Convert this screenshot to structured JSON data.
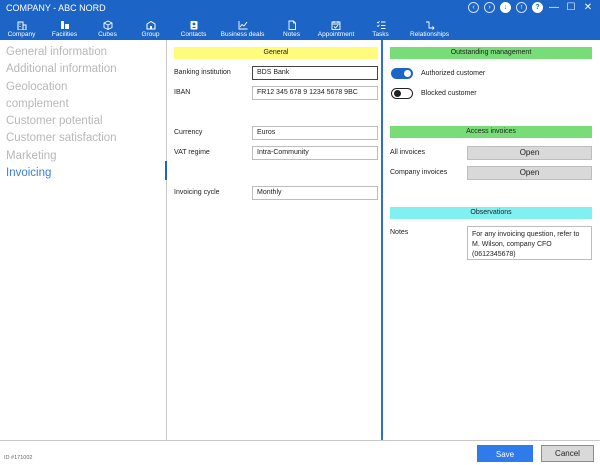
{
  "window": {
    "title": "COMPANY - ABC NORD",
    "controls": {
      "back_icon": "arrow-left-circle-icon",
      "forward_icon": "arrow-right-circle-icon",
      "download_icon": "arrow-down-circle-icon",
      "upload_icon": "arrow-up-circle-icon",
      "help_icon": "help-circle-icon",
      "help_glyph": "?",
      "minimize_glyph": "—",
      "maximize_glyph": "☐",
      "close_glyph": "✕"
    },
    "accent_color": "#1c64c6"
  },
  "toolbar": {
    "items": [
      {
        "label": "Company",
        "icon": "building-icon"
      },
      {
        "label": "Facilities",
        "icon": "facilities-icon"
      },
      {
        "label": "Cubes",
        "icon": "cube-icon"
      },
      {
        "label": "Group",
        "icon": "group-icon"
      },
      {
        "label": "Contacts",
        "icon": "contact-card-icon"
      },
      {
        "label": "Business deals",
        "icon": "chart-line-icon"
      },
      {
        "label": "Notes",
        "icon": "note-icon"
      },
      {
        "label": "Appointment",
        "icon": "calendar-check-icon"
      },
      {
        "label": "Tasks",
        "icon": "tasks-icon"
      },
      {
        "label": "Relationships",
        "icon": "relationships-icon"
      }
    ]
  },
  "sidebar": {
    "items": [
      {
        "label": "General information",
        "active": false
      },
      {
        "label": "Additional information",
        "active": false
      },
      {
        "label": "Geolocation",
        "active": false
      },
      {
        "label": "complement",
        "active": false
      },
      {
        "label": "Customer potential",
        "active": false
      },
      {
        "label": "Customer satisfaction",
        "active": false
      },
      {
        "label": "Marketing",
        "active": false
      },
      {
        "label": "Invoicing",
        "active": true
      }
    ]
  },
  "general": {
    "header": "General",
    "header_color": "#fffb7d",
    "banking_institution_label": "Banking institution",
    "banking_institution_value": "BDS Bank",
    "iban_label": "IBAN",
    "iban_value": "FR12 345 678 9 1234 5678 9BC",
    "currency_label": "Currency",
    "currency_value": "Euros",
    "vat_regime_label": "VAT regime",
    "vat_regime_value": "Intra-Community",
    "invoicing_cycle_label": "Invoicing cycle",
    "invoicing_cycle_value": "Monthly"
  },
  "outstanding": {
    "header": "Outstanding management",
    "header_color": "#78dc78",
    "authorized_label": "Authorized customer",
    "authorized_on": true,
    "blocked_label": "Blocked customer",
    "blocked_on": false
  },
  "access_invoices": {
    "header": "Access invoices",
    "header_color": "#78dc78",
    "all_invoices_label": "All invoices",
    "all_invoices_button": "Open",
    "company_invoices_label": "Company invoices",
    "company_invoices_button": "Open"
  },
  "observations": {
    "header": "Observations",
    "header_color": "#80f0f0",
    "notes_label": "Notes",
    "notes_value": "For any invoicing question, refer to M. Wilson, company CFO (0612345678)"
  },
  "footer": {
    "record_id": "ID #171002",
    "save_label": "Save",
    "cancel_label": "Cancel",
    "save_color": "#2f7bec"
  }
}
